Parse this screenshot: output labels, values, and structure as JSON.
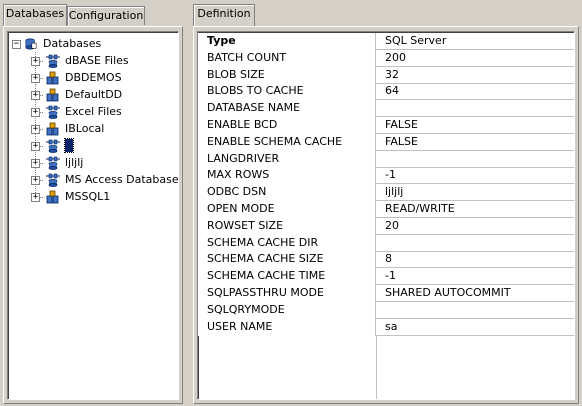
{
  "left_tabs": [
    {
      "label": "Databases",
      "active": true
    },
    {
      "label": "Configuration",
      "active": false
    }
  ],
  "right_tabs": [
    {
      "label": "Definition",
      "active": true
    }
  ],
  "tree": {
    "root": {
      "label": "Databases",
      "icon": "databases-root-icon",
      "expanded": true
    },
    "items": [
      {
        "label": "dBASE Files",
        "icon": "database-connector-icon"
      },
      {
        "label": "DBDEMOS",
        "icon": "database-local-icon"
      },
      {
        "label": "DefaultDD",
        "icon": "database-local-icon"
      },
      {
        "label": "Excel Files",
        "icon": "database-connector-icon"
      },
      {
        "label": "IBLocal",
        "icon": "database-local-icon"
      },
      {
        "label": "",
        "icon": "database-connector-icon",
        "selected": true
      },
      {
        "label": "ljljlj",
        "icon": "database-connector-icon"
      },
      {
        "label": "MS Access Database",
        "icon": "database-connector-icon"
      },
      {
        "label": "MSSQL1",
        "icon": "database-local-icon"
      }
    ]
  },
  "properties": [
    {
      "name": "Type",
      "value": "SQL Server",
      "header": true
    },
    {
      "name": "BATCH COUNT",
      "value": "200"
    },
    {
      "name": "BLOB SIZE",
      "value": "32"
    },
    {
      "name": "BLOBS TO CACHE",
      "value": "64"
    },
    {
      "name": "DATABASE NAME",
      "value": ""
    },
    {
      "name": "ENABLE BCD",
      "value": "FALSE"
    },
    {
      "name": "ENABLE SCHEMA CACHE",
      "value": "FALSE"
    },
    {
      "name": "LANGDRIVER",
      "value": ""
    },
    {
      "name": "MAX ROWS",
      "value": "-1"
    },
    {
      "name": "ODBC DSN",
      "value": "ljljlj"
    },
    {
      "name": "OPEN MODE",
      "value": "READ/WRITE"
    },
    {
      "name": "ROWSET SIZE",
      "value": "20"
    },
    {
      "name": "SCHEMA CACHE DIR",
      "value": ""
    },
    {
      "name": "SCHEMA CACHE SIZE",
      "value": "8"
    },
    {
      "name": "SCHEMA CACHE TIME",
      "value": "-1"
    },
    {
      "name": "SQLPASSTHRU MODE",
      "value": "SHARED AUTOCOMMIT"
    },
    {
      "name": "SQLQRYMODE",
      "value": ""
    },
    {
      "name": "USER NAME",
      "value": "sa"
    }
  ],
  "colors": {
    "face": "#d4d0c8",
    "selection": "#0a246a",
    "grid_line": "#c0c0c0"
  }
}
